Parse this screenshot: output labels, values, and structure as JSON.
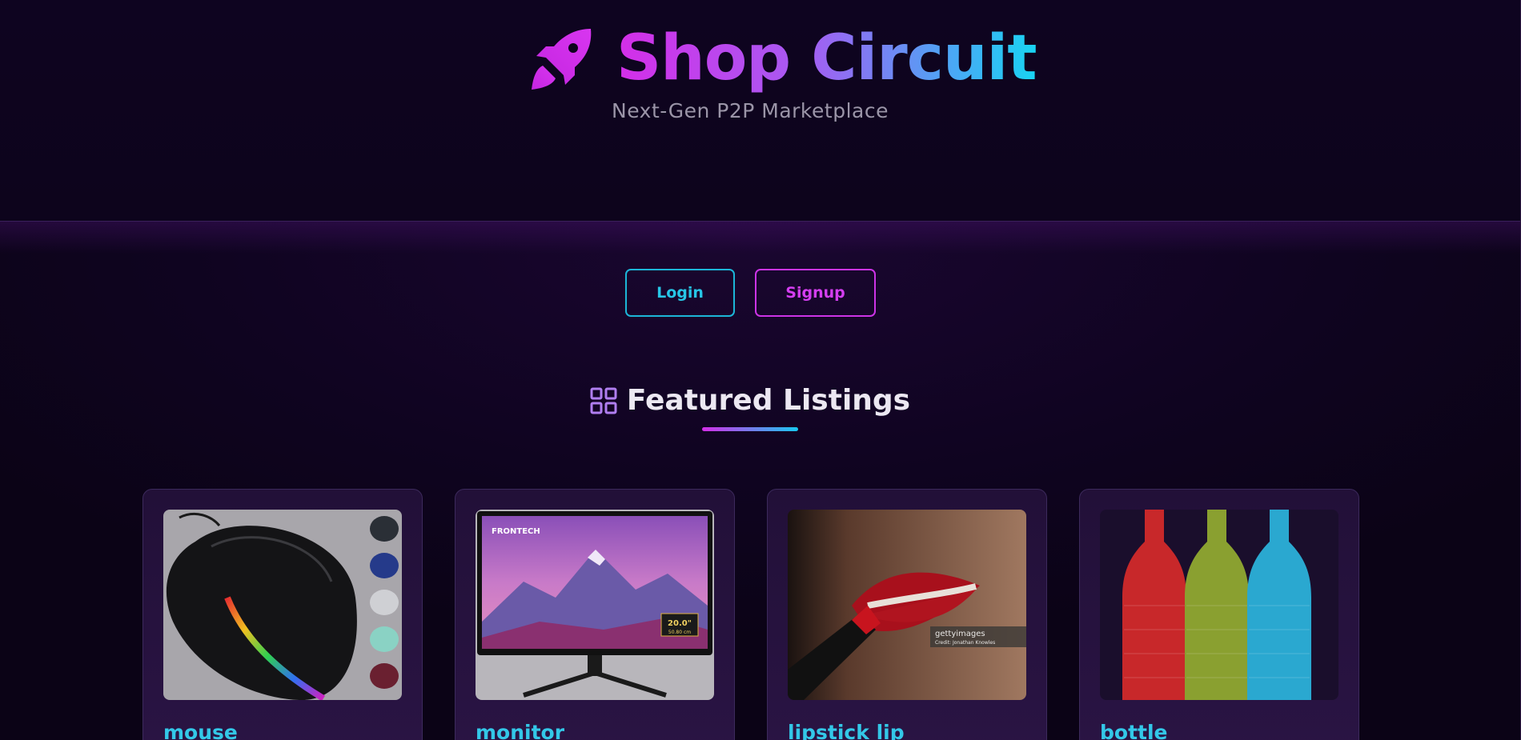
{
  "brand": {
    "title": "Shop Circuit",
    "subtitle": "Next-Gen P2P Marketplace",
    "icon": "rocket-icon"
  },
  "auth": {
    "login_label": "Login",
    "signup_label": "Signup"
  },
  "featured": {
    "title": "Featured Listings",
    "icon": "grid-icon"
  },
  "listings": [
    {
      "title": "mouse",
      "image": "black gaming mouse with rainbow light strip"
    },
    {
      "title": "monitor",
      "image": "FRONTECH 20.0\" monitor showing mountain landscape"
    },
    {
      "title": "lipstick lip",
      "image": "red lipstick applied to lips"
    },
    {
      "title": "bottle",
      "image": "three colored textured bottles"
    }
  ],
  "image_text": {
    "monitor_brand": "FRONTECH",
    "monitor_size": "20.0\"",
    "monitor_size_cm": "50.80 cm",
    "watermark": "gettyimages",
    "credit": "Credit: Jonathan Knowles"
  },
  "colors": {
    "background": "#0c0418",
    "accent_magenta": "#d42ee8",
    "accent_cyan": "#18d4f2",
    "card_title": "#33c8e8"
  }
}
